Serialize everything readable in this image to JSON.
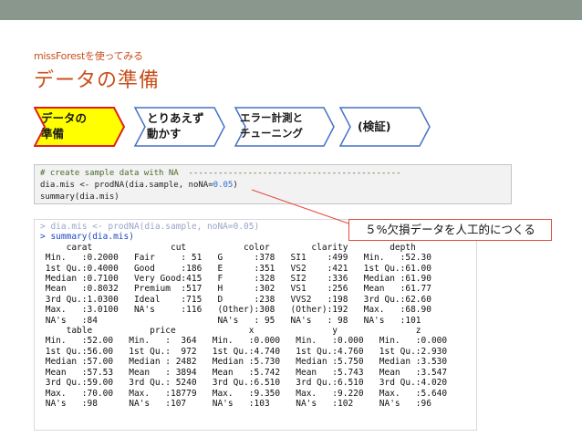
{
  "header": {
    "subtitle": "missForestを使ってみる",
    "title": "データの準備"
  },
  "steps": [
    {
      "label": "データの\n準備",
      "active": true
    },
    {
      "label": "とりあえず\n動かす",
      "active": false
    },
    {
      "label": "エラー計測と\nチューニング",
      "active": false
    },
    {
      "label": "(検証)",
      "active": false
    }
  ],
  "code": {
    "line1_comment": "# create sample data with NA  -------------------------------------------",
    "line2_prefix": "dia.mis <- prodNA(dia.sample, noNA=",
    "line2_number": "0.05",
    "line2_suffix": ")",
    "line3": "summary(dia.mis)"
  },
  "callout": {
    "text": "５%欠損データを人工的につくる"
  },
  "console": {
    "faded_line": "> dia.mis <- prodNA(dia.sample, noNA=0.05)",
    "lines": [
      "> summary(dia.mis)",
      "     carat               cut           color        clarity        depth",
      " Min.   :0.2000   Fair     : 51   G      :378   SI1    :499   Min.   :52.30",
      " 1st Qu.:0.4000   Good     :186   E      :351   VS2    :421   1st Qu.:61.00",
      " Median :0.7100   Very Good:415   F      :328   SI2    :336   Median :61.90",
      " Mean   :0.8032   Premium  :517   H      :302   VS1    :256   Mean   :61.77",
      " 3rd Qu.:1.0300   Ideal    :715   D      :238   VVS2   :198   3rd Qu.:62.60",
      " Max.   :3.0100   NA's     :116   (Other):308   (Other):192   Max.   :68.90",
      " NA's   :84                       NA's   : 95   NA's   : 98   NA's   :101",
      "     table           price              x               y               z",
      " Min.   :52.00   Min.   :  364   Min.   :0.000   Min.   :0.000   Min.   :0.000",
      " 1st Qu.:56.00   1st Qu.:  972   1st Qu.:4.740   1st Qu.:4.760   1st Qu.:2.930",
      " Median :57.00   Median : 2482   Median :5.730   Median :5.750   Median :3.530",
      " Mean   :57.53   Mean   : 3894   Mean   :5.742   Mean   :5.743   Mean   :3.547",
      " 3rd Qu.:59.00   3rd Qu.: 5240   3rd Qu.:6.510   3rd Qu.:6.510   3rd Qu.:4.020",
      " Max.   :70.00   Max.   :18779   Max.   :9.350   Max.   :9.220   Max.   :5.640",
      " NA's   :98      NA's   :107     NA's   :103     NA's   :102     NA's   :96"
    ]
  },
  "colors": {
    "accent": "#c8501c",
    "step_active_fill": "#ffff00",
    "step_active_border": "#e02020",
    "step_border": "#4472c4",
    "top_bar": "#8a978c",
    "callout_border": "#e64b3c"
  }
}
